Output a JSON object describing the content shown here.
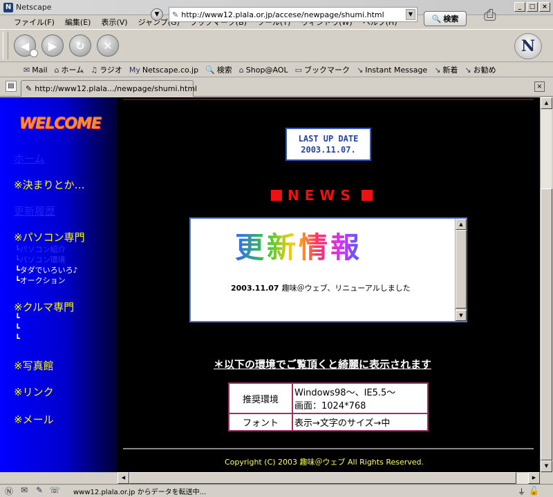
{
  "window": {
    "title": "Netscape",
    "app_icon": "N"
  },
  "menu": [
    "ファイル(F)",
    "編集(E)",
    "表示(V)",
    "ジャンプ(G)",
    "ブックマーク(B)",
    "ツール(T)",
    "ウィンドウ(W)",
    "ヘルプ(H)"
  ],
  "nav": {
    "url": "http://www12.plala.or.jp/accese/newpage/shumi.html",
    "search_label": "検索",
    "logo": "N"
  },
  "personal_toolbar": [
    {
      "icon": "mail-icon",
      "label": "Mail"
    },
    {
      "icon": "home-icon",
      "label": "ホーム"
    },
    {
      "icon": "radio-icon",
      "label": "ラジオ"
    },
    {
      "icon": "my-icon",
      "label": "Netscape.co.jp"
    },
    {
      "icon": "search-icon",
      "label": "検索"
    },
    {
      "icon": "shop-icon",
      "label": "Shop@AOL"
    },
    {
      "icon": "folder-icon",
      "label": "ブックマーク"
    },
    {
      "icon": "link-icon",
      "label": "Instant Message"
    },
    {
      "icon": "link-icon",
      "label": "新着"
    },
    {
      "icon": "link-icon",
      "label": "お勧め"
    }
  ],
  "tab": {
    "label": "http://www12.plala.../newpage/shumi.html"
  },
  "page": {
    "welcome": "WELCOME",
    "sidebar": [
      {
        "label": "ホーム",
        "dim": true
      },
      {
        "label": "※決まりとか…",
        "dim": false
      },
      {
        "label": "更新履歴",
        "dim": true
      },
      {
        "label": "※パソコン専門",
        "dim": false
      },
      {
        "label": "※クルマ専門",
        "dim": false
      },
      {
        "label": "※写真館",
        "dim": false
      },
      {
        "label": "※リンク",
        "dim": false
      },
      {
        "label": "※メール",
        "dim": false
      }
    ],
    "pc_subitems": [
      {
        "label": "┗パソコン紹介",
        "dim": true
      },
      {
        "label": "┗パソコン環境",
        "dim": true
      },
      {
        "label": "┗タダでいろいろ♪",
        "dim": false
      },
      {
        "label": "┗オークション",
        "dim": false
      }
    ],
    "car_subitems": [
      "┗",
      "┗",
      "┗"
    ],
    "last_update": {
      "label": "LAST UP DATE",
      "date": "2003.11.07."
    },
    "news_heading": "NEWS",
    "news_title": "更新情報",
    "news_entry": {
      "date": "2003.11.07",
      "text": "趣味＠ウェブ、リニューアルしました"
    },
    "notice": "＊以下の環境でご覧頂くと綺麗に表示されます",
    "env_table": [
      {
        "label": "推奨環境",
        "value_line1": "Windows98〜、IE5.5〜",
        "value_line2": "画面：1024*768"
      },
      {
        "label": "フォント",
        "value_line1": "表示→文字のサイズ→中",
        "value_line2": ""
      }
    ],
    "copyright": "Copyright (C) 2003 趣味＠ウェブ All Rights Reserved."
  },
  "status": {
    "text": "www12.plala.or.jp からデータを転送中..."
  },
  "colors": {
    "sidebar_blue": "#0000ff",
    "nav_yellow": "#ffff00",
    "news_red": "#ee1111",
    "table_border": "#993366"
  }
}
